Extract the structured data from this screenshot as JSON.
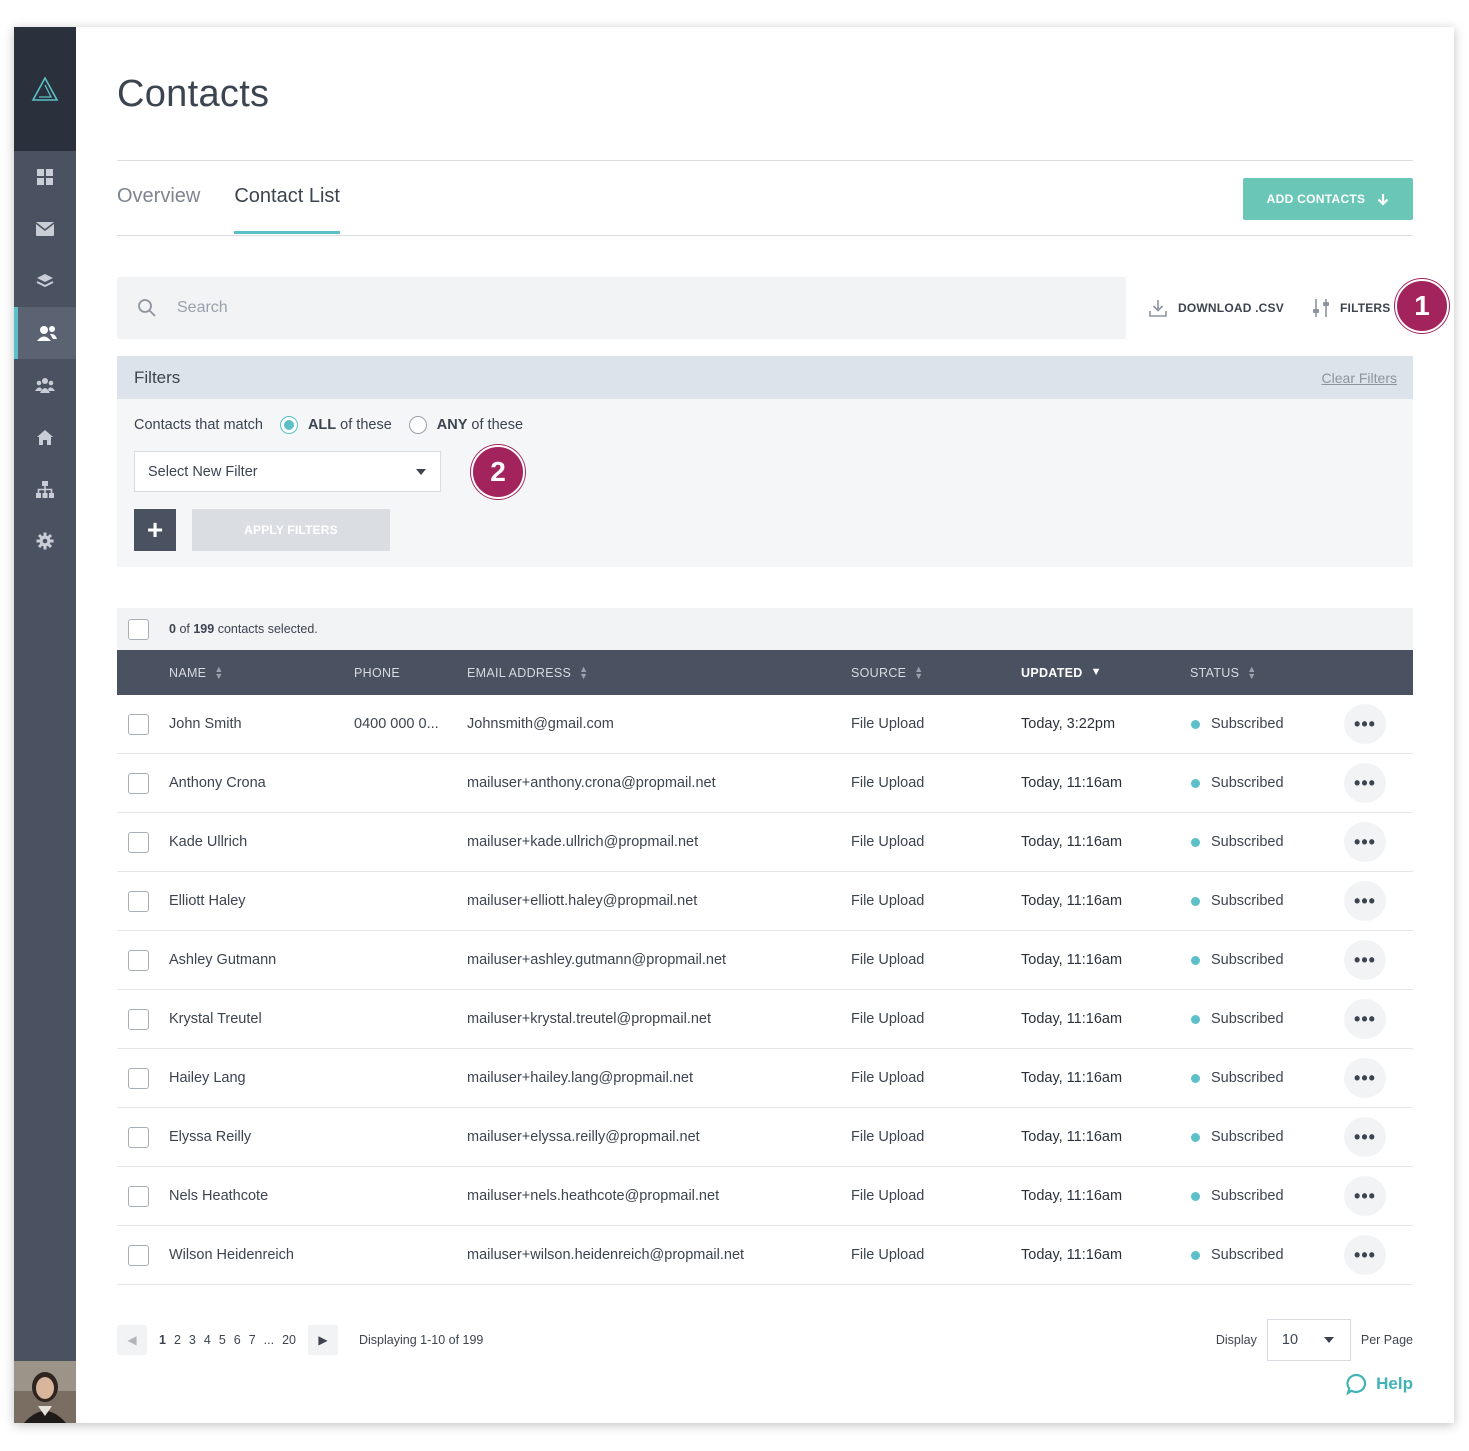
{
  "sidebar": {
    "logo_icon": "triangle-logo-icon",
    "items": [
      {
        "icon": "dashboard-grid-icon",
        "active": false
      },
      {
        "icon": "envelope-icon",
        "active": false
      },
      {
        "icon": "layers-icon",
        "active": false
      },
      {
        "icon": "contacts-icon",
        "active": true
      },
      {
        "icon": "group-icon",
        "active": false
      },
      {
        "icon": "home-icon",
        "active": false
      },
      {
        "icon": "sitemap-icon",
        "active": false
      },
      {
        "icon": "gear-icon",
        "active": false
      }
    ]
  },
  "page": {
    "title": "Contacts"
  },
  "tabs": [
    {
      "label": "Overview",
      "active": false
    },
    {
      "label": "Contact List",
      "active": true
    }
  ],
  "toolbar": {
    "add_contacts_label": "ADD CONTACTS",
    "search_placeholder": "Search",
    "download_label": "DOWNLOAD .CSV",
    "filters_label": "FILTERS"
  },
  "badges": {
    "one": "1",
    "two": "2"
  },
  "filters": {
    "title": "Filters",
    "clear_label": "Clear Filters",
    "match_prefix": "Contacts that match",
    "all_strong": "ALL",
    "all_rest": "of these",
    "any_strong": "ANY",
    "any_rest": "of these",
    "select_value": "Select New Filter",
    "plus_label": "+",
    "apply_label": "APPLY FILTERS"
  },
  "selection": {
    "count": "0",
    "of": "of",
    "total": "199",
    "suffix": "contacts selected."
  },
  "table": {
    "columns": {
      "name": "NAME",
      "phone": "PHONE",
      "email": "EMAIL ADDRESS",
      "source": "SOURCE",
      "updated": "UPDATED",
      "status": "STATUS"
    },
    "rows": [
      {
        "name": "John Smith",
        "phone": "0400 000 0...",
        "email": "Johnsmith@gmail.com",
        "source": "File Upload",
        "updated": "Today, 3:22pm",
        "status": "Subscribed"
      },
      {
        "name": "Anthony Crona",
        "phone": "",
        "email": "mailuser+anthony.crona@propmail.net",
        "source": "File Upload",
        "updated": "Today, 11:16am",
        "status": "Subscribed"
      },
      {
        "name": "Kade Ullrich",
        "phone": "",
        "email": "mailuser+kade.ullrich@propmail.net",
        "source": "File Upload",
        "updated": "Today, 11:16am",
        "status": "Subscribed"
      },
      {
        "name": "Elliott Haley",
        "phone": "",
        "email": "mailuser+elliott.haley@propmail.net",
        "source": "File Upload",
        "updated": "Today, 11:16am",
        "status": "Subscribed"
      },
      {
        "name": "Ashley Gutmann",
        "phone": "",
        "email": "mailuser+ashley.gutmann@propmail.net",
        "source": "File Upload",
        "updated": "Today, 11:16am",
        "status": "Subscribed"
      },
      {
        "name": "Krystal Treutel",
        "phone": "",
        "email": "mailuser+krystal.treutel@propmail.net",
        "source": "File Upload",
        "updated": "Today, 11:16am",
        "status": "Subscribed"
      },
      {
        "name": "Hailey Lang",
        "phone": "",
        "email": "mailuser+hailey.lang@propmail.net",
        "source": "File Upload",
        "updated": "Today, 11:16am",
        "status": "Subscribed"
      },
      {
        "name": "Elyssa Reilly",
        "phone": "",
        "email": "mailuser+elyssa.reilly@propmail.net",
        "source": "File Upload",
        "updated": "Today, 11:16am",
        "status": "Subscribed"
      },
      {
        "name": "Nels Heathcote",
        "phone": "",
        "email": "mailuser+nels.heathcote@propmail.net",
        "source": "File Upload",
        "updated": "Today, 11:16am",
        "status": "Subscribed"
      },
      {
        "name": "Wilson Heidenreich",
        "phone": "",
        "email": "mailuser+wilson.heidenreich@propmail.net",
        "source": "File Upload",
        "updated": "Today, 11:16am",
        "status": "Subscribed"
      }
    ]
  },
  "pagination": {
    "pages": [
      "1",
      "2",
      "3",
      "4",
      "5",
      "6",
      "7",
      "...",
      "20"
    ],
    "current": "1",
    "displaying": "Displaying 1-10 of 199",
    "display_label": "Display",
    "per_page_value": "10",
    "per_page_label": "Per Page"
  },
  "help": {
    "label": "Help"
  },
  "colors": {
    "accent": "#5bc0c7",
    "add_button": "#6ac7b8",
    "badge": "#a3245c",
    "sidebar": "#4a5160",
    "table_header": "#4a5160"
  }
}
